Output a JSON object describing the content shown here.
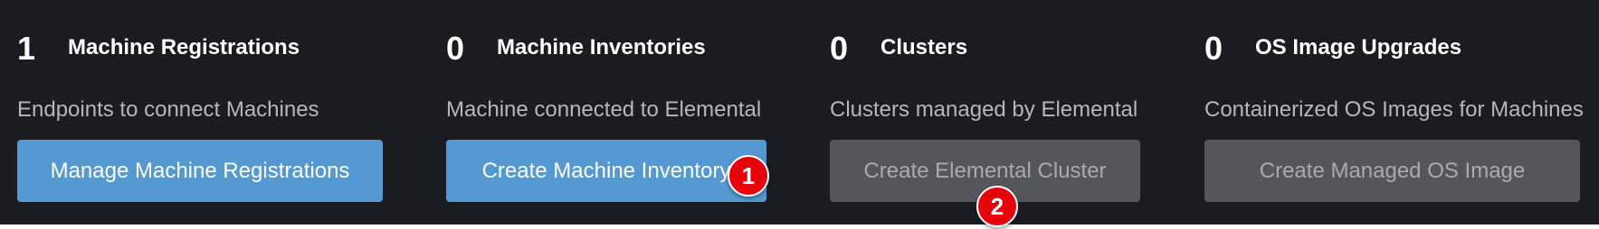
{
  "cards": [
    {
      "count": "1",
      "title": "Machine Registrations",
      "description": "Endpoints to connect Machines",
      "button_label": "Manage Machine Registrations",
      "button_state": "enabled"
    },
    {
      "count": "0",
      "title": "Machine Inventories",
      "description": "Machine connected to Elemental",
      "button_label": "Create Machine Inventory",
      "button_state": "enabled"
    },
    {
      "count": "0",
      "title": "Clusters",
      "description": "Clusters managed by Elemental",
      "button_label": "Create Elemental Cluster",
      "button_state": "disabled"
    },
    {
      "count": "0",
      "title": "OS Image Upgrades",
      "description": "Containerized OS Images for Machines",
      "button_label": "Create Managed OS Image",
      "button_state": "disabled"
    }
  ],
  "annotations": [
    {
      "label": "1"
    },
    {
      "label": "2"
    }
  ],
  "colors": {
    "panel_background": "#1b1c21",
    "primary_button": "#5499d2",
    "disabled_button": "#55565c",
    "marker": "#e8000b"
  }
}
